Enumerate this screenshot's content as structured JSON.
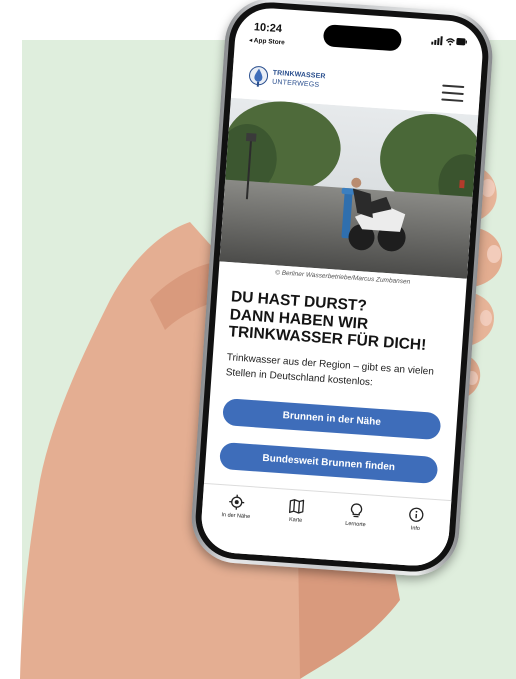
{
  "status_bar": {
    "time": "10:24",
    "back_label": "◂ App Store"
  },
  "header": {
    "logo_line1": "TRINKWASSER",
    "logo_line2": "UNTERWEGS"
  },
  "photo_caption": "© Berliner Wasserbetriebe/Marcus Zumbansen",
  "headline": [
    "DU HAST DURST?",
    "DANN HABEN WIR",
    "TRINKWASSER FÜR DICH!"
  ],
  "intro_text": "Trinkwasser aus der Region – gibt es an vielen Stellen in Deutschland kostenlos:",
  "buttons": {
    "nearby": "Brunnen in der Nähe",
    "nationwide": "Bundesweit Brunnen finden"
  },
  "tabs": [
    {
      "label": "In der Nähe",
      "icon": "location-target-icon"
    },
    {
      "label": "Karte",
      "icon": "map-icon"
    },
    {
      "label": "Lernorte",
      "icon": "lightbulb-icon"
    },
    {
      "label": "Info",
      "icon": "info-icon"
    }
  ],
  "colors": {
    "accent": "#3e6dba",
    "brand": "#2a4f8e",
    "background": "#dfeedd"
  }
}
